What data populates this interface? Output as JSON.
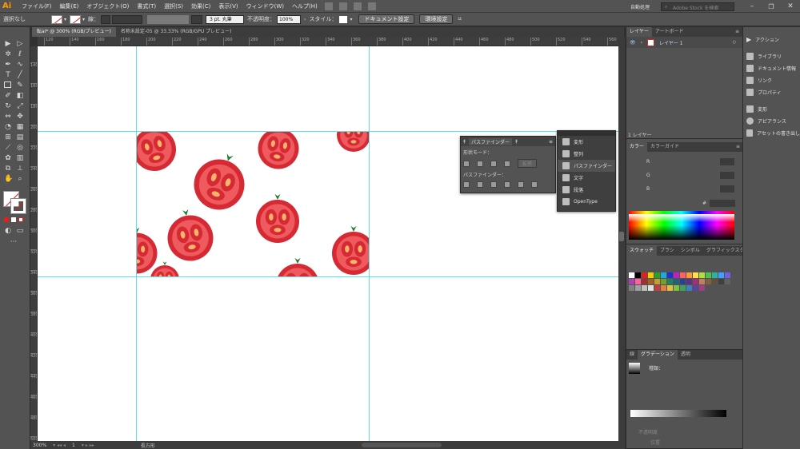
{
  "app": {
    "logo": "Ai",
    "workspace": "自動処理",
    "search_placeholder": "Adobe Stock を検索"
  },
  "menu": [
    "ファイル(F)",
    "編集(E)",
    "オブジェクト(O)",
    "書式(T)",
    "選択(S)",
    "効果(C)",
    "表示(V)",
    "ウィンドウ(W)",
    "ヘルプ(H)"
  ],
  "control": {
    "selection_label": "選択なし",
    "stroke_label": "線：",
    "stroke_weight": "3 pt. 丸筆",
    "opacity_label": "不透明度：",
    "opacity_value": "100%",
    "style_label": "スタイル：",
    "doc_setup": "ドキュメント設定",
    "prefs": "環境設定"
  },
  "tabs": [
    {
      "label": "転ai* @ 300% (RGB/プレビュー)",
      "active": true
    },
    {
      "label": "名称未設定-05 @ 33.33% (RGB/GPU プレビュー)",
      "active": false
    }
  ],
  "ruler_h": [
    "120",
    "140",
    "160",
    "180",
    "200",
    "220",
    "240",
    "260",
    "280",
    "300",
    "320",
    "340",
    "360",
    "380",
    "400",
    "420",
    "440",
    "460",
    "480",
    "500",
    "520",
    "540",
    "560"
  ],
  "ruler_v": [
    "140",
    "160",
    "180",
    "200",
    "220",
    "240",
    "260",
    "280",
    "300",
    "320",
    "340",
    "360",
    "380",
    "400",
    "420",
    "440",
    "460",
    "480",
    "500"
  ],
  "status": {
    "zoom": "300%",
    "artboard": "1",
    "tool_name": "長方形"
  },
  "pathfinder": {
    "tabs": [
      "変形",
      "整列",
      "パスファインダー"
    ],
    "shape_modes_label": "形状モード：",
    "expand": "拡張",
    "pathfinders_label": "パスファインダー："
  },
  "dock_menu": [
    "変形",
    "整列",
    "パスファインダー",
    "文字",
    "段落",
    "OpenType"
  ],
  "layers": {
    "tabs": [
      "レイヤー",
      "アートボード"
    ],
    "layer_name": "レイヤー 1",
    "footer": "1 レイヤー"
  },
  "color": {
    "tabs": [
      "カラー",
      "カラーガイド"
    ],
    "channels": [
      "R",
      "G",
      "B"
    ],
    "hex_label": "#"
  },
  "swatches": {
    "tabs": [
      "スウォッチ",
      "ブラシ",
      "シンボル",
      "グラフィックスタイル"
    ]
  },
  "gradient": {
    "tabs": [
      "線",
      "グラデーション",
      "透明"
    ],
    "type_label": "種類：",
    "opacity_label": "不透明度",
    "position_label": "位置"
  },
  "right_dock": [
    "アクション",
    "ライブラリ",
    "ドキュメント情報",
    "リンク",
    "プロパティ",
    "変形",
    "アピアランス",
    "アセットの書き出し"
  ]
}
